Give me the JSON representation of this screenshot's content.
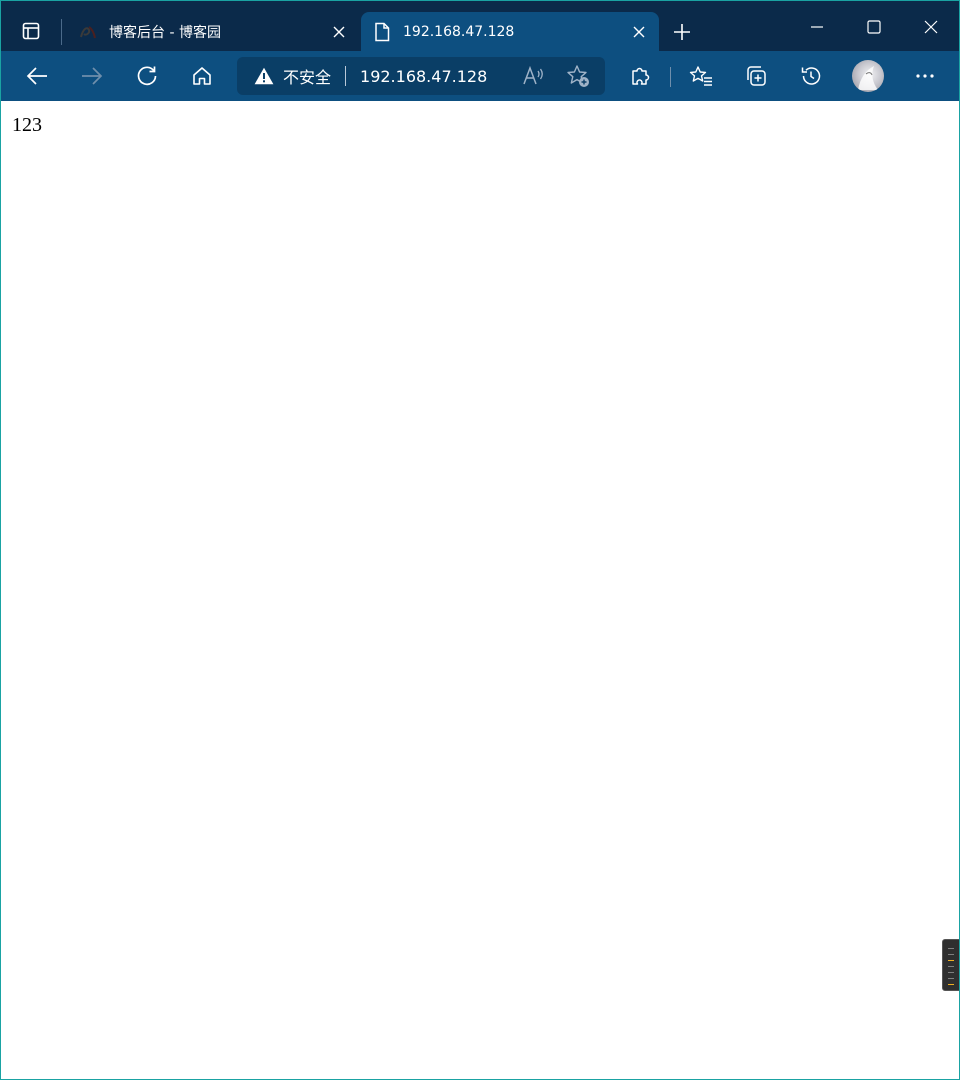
{
  "tabs": [
    {
      "title": "博客后台 - 博客园",
      "active": false,
      "favicon": "cnblogs-logo-icon"
    },
    {
      "title": "192.168.47.128",
      "active": true,
      "favicon": "page-icon"
    }
  ],
  "addressbar": {
    "security_label": "不安全",
    "url": "192.168.47.128"
  },
  "page": {
    "text": "123"
  },
  "colors": {
    "titlebar": "#0b2a4a",
    "toolbar": "#0d4f80",
    "addressbar": "#0a3e66",
    "window_border": "#1aa3a3"
  }
}
